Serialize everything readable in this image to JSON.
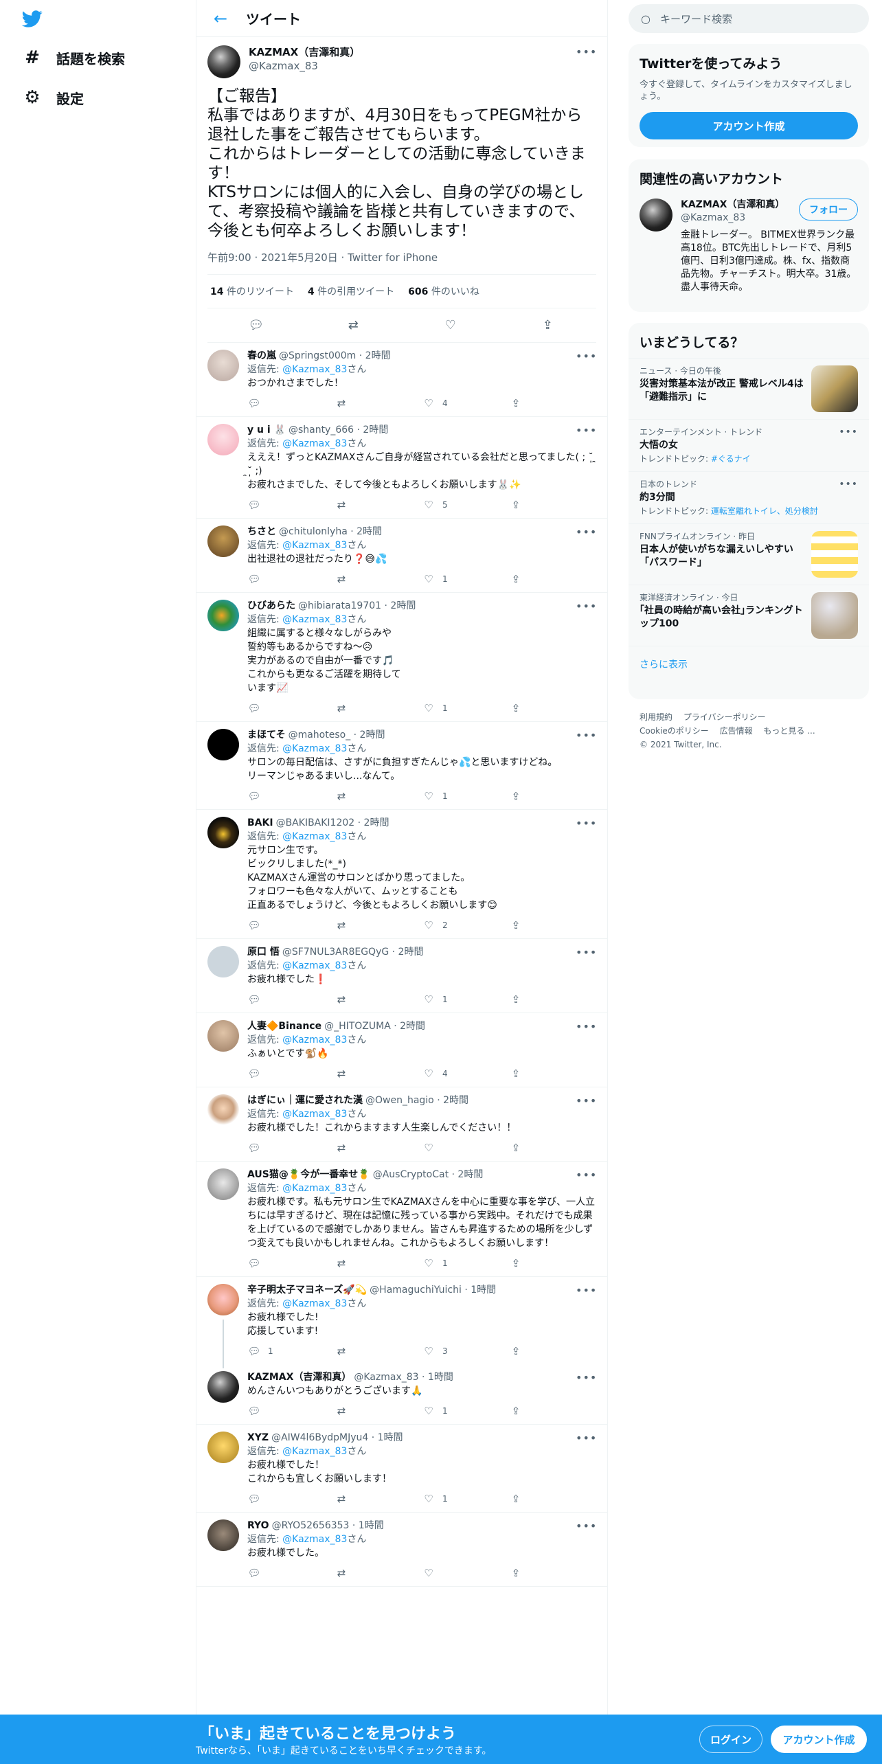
{
  "nav": {
    "items": [
      {
        "label": "話題を検索",
        "icon": "hashtag-icon"
      },
      {
        "label": "設定",
        "icon": "gear-icon"
      }
    ]
  },
  "header": {
    "title": "ツイート"
  },
  "main_tweet": {
    "name": "KAZMAX（吉澤和真）",
    "handle": "@Kazmax_83",
    "text": "【ご報告】\n私事ではありますが、4月30日をもってPEGM社から退社した事をご報告させてもらいます。\nこれからはトレーダーとしての活動に専念していきます！\nKTSサロンには個人的に入会し、自身の学びの場として、考察投稿や議論を皆様と共有していきますので、今後とも何卒よろしくお願いします！",
    "timestamp": "午前9:00 · 2021年5月20日 · Twitter for iPhone",
    "retweets": "14",
    "retweets_label": "件のリツイート",
    "quotes": "4",
    "quotes_label": "件の引用ツイート",
    "likes": "606",
    "likes_label": "件のいいね"
  },
  "reply_label": "返信先: ",
  "reply_suffix": "さん",
  "replies": [
    {
      "name": "春の嵐",
      "meta": "@Springst000m · 2時間",
      "mention": "@Kazmax_83",
      "text": "おつかれさまでした！",
      "reply_count": "",
      "retweet_count": "",
      "like_count": "4",
      "avatar": "av-gray"
    },
    {
      "name": "y u i 🐰",
      "meta": "@shanty_666 · 2時間",
      "mention": "@Kazmax_83",
      "text": "えええ！ずっとKAZMAXさんご自身が経営されている会社だと思ってました( ; ˘̩̩ ̯˘̩̩ ;)\nお疲れさまでした、そして今後ともよろしくお願いします🐰✨",
      "reply_count": "",
      "retweet_count": "",
      "like_count": "5",
      "avatar": "av-pink"
    },
    {
      "name": "ちさと",
      "meta": "@chitulonlyha · 2時間",
      "mention": "@Kazmax_83",
      "text": "出社退社の退社だったり❓😅💦",
      "reply_count": "",
      "retweet_count": "",
      "like_count": "1",
      "avatar": "av-brown"
    },
    {
      "name": "ひびあらた",
      "meta": "@hibiarata19701 · 2時間",
      "mention": "@Kazmax_83",
      "text": "組織に属すると様々なしがらみや\n誓約等もあるからですね～😥\n実力があるので自由が一番です🎵\nこれからも更なるご活躍を期待して\nいます📈",
      "reply_count": "",
      "retweet_count": "",
      "like_count": "1",
      "avatar": "av-green"
    },
    {
      "name": "まほてそ",
      "meta": "@mahoteso_ · 2時間",
      "mention": "@Kazmax_83",
      "text": "サロンの毎日配信は、さすがに負担すぎたんじゃ💦と思いますけどね。\nリーマンじゃあるまいし...なんて。",
      "reply_count": "",
      "retweet_count": "",
      "like_count": "1",
      "avatar": "av-black"
    },
    {
      "name": "BAKI",
      "meta": "@BAKIBAKI1202 · 2時間",
      "mention": "@Kazmax_83",
      "text": "元サロン生です。\nビックリしました(*_*)\nKAZMAXさん運営のサロンとばかり思ってました。\nフォロワーも色々な人がいて、ムッとすることも\n正直あるでしょうけど、今後ともよろしくお願いします😊",
      "reply_count": "",
      "retweet_count": "",
      "like_count": "2",
      "avatar": "av-baki"
    },
    {
      "name": "原口 悟",
      "meta": "@SF7NUL3AR8EGQyG · 2時間",
      "mention": "@Kazmax_83",
      "text": "お疲れ様でした❗",
      "reply_count": "",
      "retweet_count": "",
      "like_count": "1",
      "avatar": "av-default"
    },
    {
      "name": "人妻🔶Binance",
      "meta": "@_HITOZUMA · 2時間",
      "mention": "@Kazmax_83",
      "text": "ふぁいとです🐒🔥",
      "reply_count": "",
      "retweet_count": "",
      "like_count": "4",
      "avatar": "av-tan"
    },
    {
      "name": "はぎにぃ｜運に愛された漢",
      "meta": "@Owen_hagio · 2時間",
      "mention": "@Kazmax_83",
      "text": "お疲れ様でした！これからますます人生楽しんでください！！",
      "reply_count": "",
      "retweet_count": "",
      "like_count": "",
      "avatar": "av-face"
    },
    {
      "name": "AUS猫@🍍今が一番幸せ🍍",
      "meta": "@AusCryptoCat · 2時間",
      "mention": "@Kazmax_83",
      "text": "お疲れ様です。私も元サロン生でKAZMAXさんを中心に重要な事を学び、一人立ちには早すぎるけど、現在は記憶に残っている事から実践中。それだけでも成果を上げているので感謝でしかありません。皆さんも昇進するための場所を少しずつ変えても良いかもしれませんね。これからもよろしくお願いします！",
      "reply_count": "",
      "retweet_count": "",
      "like_count": "1",
      "avatar": "av-cat"
    },
    {
      "name": "辛子明太子マヨネーズ🚀💫",
      "meta": "@HamaguchiYuichi · 1時間",
      "mention": "@Kazmax_83",
      "text": "お疲れ様でした!\n応援しています!",
      "reply_count": "1",
      "retweet_count": "",
      "like_count": "3",
      "avatar": "av-doll"
    },
    {
      "name": "KAZMAX（吉澤和真）",
      "meta": "@Kazmax_83 · 1時間",
      "mention": "",
      "text": "めんさんいつもありがとうございます🙏",
      "reply_count": "",
      "retweet_count": "",
      "like_count": "1",
      "avatar": "av-kazmax"
    },
    {
      "name": "XYZ",
      "meta": "@AIW4l6BydpMJyu4 · 1時間",
      "mention": "@Kazmax_83",
      "text": "お疲れ様でした！\nこれからも宜しくお願いします！",
      "reply_count": "",
      "retweet_count": "",
      "like_count": "1",
      "avatar": "av-gold"
    },
    {
      "name": "RYO",
      "meta": "@RYO52656353 · 1時間",
      "mention": "@Kazmax_83",
      "text": "お疲れ様でした。",
      "reply_count": "",
      "retweet_count": "",
      "like_count": "",
      "avatar": "av-dark"
    }
  ],
  "search": {
    "placeholder": "キーワード検索"
  },
  "signup_panel": {
    "title": "Twitterを使ってみよう",
    "description": "今すぐ登録して、タイムラインをカスタマイズしましょう。",
    "button": "アカウント作成"
  },
  "related_panel": {
    "title": "関連性の高いアカウント",
    "name": "KAZMAX（吉澤和真）",
    "handle": "@Kazmax_83",
    "follow": "フォロー",
    "bio": "金融トレーダー。 BITMEX世界ランク最高18位。BTC先出しトレードで、月利5億円、日利3億円達成。株、fx、指数商品先物。チャーチスト。明大卒。31歳。盡人事待天命。"
  },
  "trends_panel": {
    "title": "いまどうしてる？",
    "items": [
      {
        "category": "ニュース · 今日の午後",
        "title": "災害対策基本法が改正 警戒レベル4は「避難指示」に",
        "sub": "",
        "tags": "",
        "image": "img-news"
      },
      {
        "category": "エンターテインメント · トレンド",
        "title": "大悟の女",
        "sub": "トレンドトピック: ",
        "tags": "#ぐるナイ",
        "image": ""
      },
      {
        "category": "日本のトレンド",
        "title": "約3分間",
        "sub": "トレンドトピック: ",
        "tags": "運転室離れトイレ、処分検討",
        "image": ""
      },
      {
        "category": "FNNプライムオンライン · 昨日",
        "title": "日本人が使いがちな漏えいしやすい「パスワード」",
        "sub": "",
        "tags": "",
        "image": "img-pw"
      },
      {
        "category": "東洋経済オンライン · 今日",
        "title": "｢社員の時給が高い会社｣ランキングトップ100",
        "sub": "",
        "tags": "",
        "image": "img-clock"
      }
    ],
    "show_more": "さらに表示"
  },
  "footer": {
    "links": [
      "利用規約",
      "プライバシーポリシー",
      "Cookieのポリシー",
      "広告情報",
      "もっと見る ..."
    ],
    "copyright": "© 2021 Twitter, Inc."
  },
  "bottom_bar": {
    "title": "「いま」起きていることを見つけよう",
    "subtitle": "Twitterなら、「いま」起きていることをいち早くチェックできます。",
    "login": "ログイン",
    "signup": "アカウント作成"
  },
  "colors": {
    "accent": "#1d9bf0",
    "text": "#0f1419",
    "muted": "#536471"
  }
}
